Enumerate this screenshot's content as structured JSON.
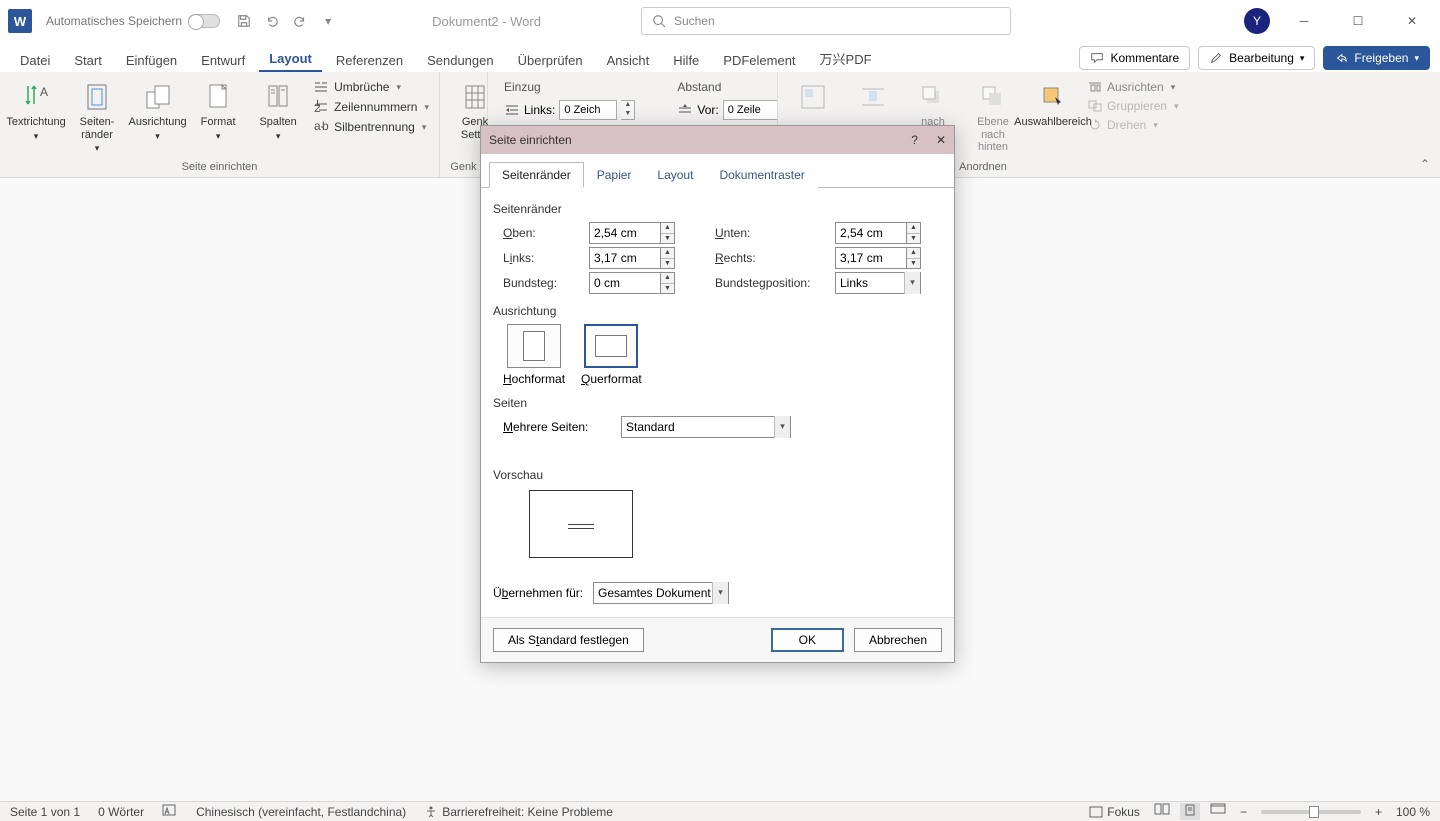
{
  "titlebar": {
    "autosave": "Automatisches Speichern",
    "doc": "Dokument2 - Word",
    "search_placeholder": "Suchen",
    "avatar": "Y"
  },
  "tabs": [
    "Datei",
    "Start",
    "Einfügen",
    "Entwurf",
    "Layout",
    "Referenzen",
    "Sendungen",
    "Überprüfen",
    "Ansicht",
    "Hilfe",
    "PDFelement",
    "万兴PDF"
  ],
  "active_tab": "Layout",
  "tabs_right": {
    "comments": "Kommentare",
    "editing": "Bearbeitung",
    "share": "Freigeben"
  },
  "ribbon": {
    "group1": {
      "label": "Seite einrichten",
      "text_direction": "Textrichtung",
      "margins": "Seiten-\nränder",
      "orientation": "Ausrichtung",
      "size": "Format",
      "columns": "Spalten",
      "breaks": "Umbrüche",
      "line_numbers": "Zeilennummern",
      "hyphenation": "Silbentrennung"
    },
    "group2": {
      "label": "Genk",
      "genko": "Genk Settin"
    },
    "group3": {
      "einzug": "Einzug",
      "abstand": "Abstand",
      "links": "Links:",
      "vor": "Vor:",
      "left_val": "0 Zeich",
      "top_val": "0 Zeile"
    },
    "anordnen": {
      "label": "Anordnen",
      "forward": "nach",
      "backward": "Ebene nach hinten",
      "selection": "Auswahlbereich",
      "align": "Ausrichten",
      "group": "Gruppieren",
      "rotate": "Drehen"
    }
  },
  "dialog": {
    "title": "Seite einrichten",
    "tabs": [
      "Seitenränder",
      "Papier",
      "Layout",
      "Dokumentraster"
    ],
    "active_tab": "Seitenränder",
    "sec_margins": "Seitenränder",
    "oben": "Oben:",
    "oben_v": "2,54 cm",
    "unten": "Unten:",
    "unten_v": "2,54 cm",
    "links": "Links:",
    "links_v": "3,17 cm",
    "rechts": "Rechts:",
    "rechts_v": "3,17 cm",
    "gutter": "Bundsteg:",
    "gutter_v": "0 cm",
    "gutter_pos": "Bundstegposition:",
    "gutter_pos_v": "Links",
    "sec_orient": "Ausrichtung",
    "portrait": "Hochformat",
    "landscape": "Querformat",
    "sec_pages": "Seiten",
    "multi_pages": "Mehrere Seiten:",
    "multi_v": "Standard",
    "sec_preview": "Vorschau",
    "apply": "Übernehmen für:",
    "apply_v": "Gesamtes Dokument",
    "set_default": "Als Standard festlegen",
    "ok": "OK",
    "cancel": "Abbrechen"
  },
  "status": {
    "page": "Seite 1 von 1",
    "words": "0 Wörter",
    "lang": "Chinesisch (vereinfacht, Festlandchina)",
    "accessibility": "Barrierefreiheit: Keine Probleme",
    "focus": "Fokus",
    "zoom": "100 %"
  }
}
